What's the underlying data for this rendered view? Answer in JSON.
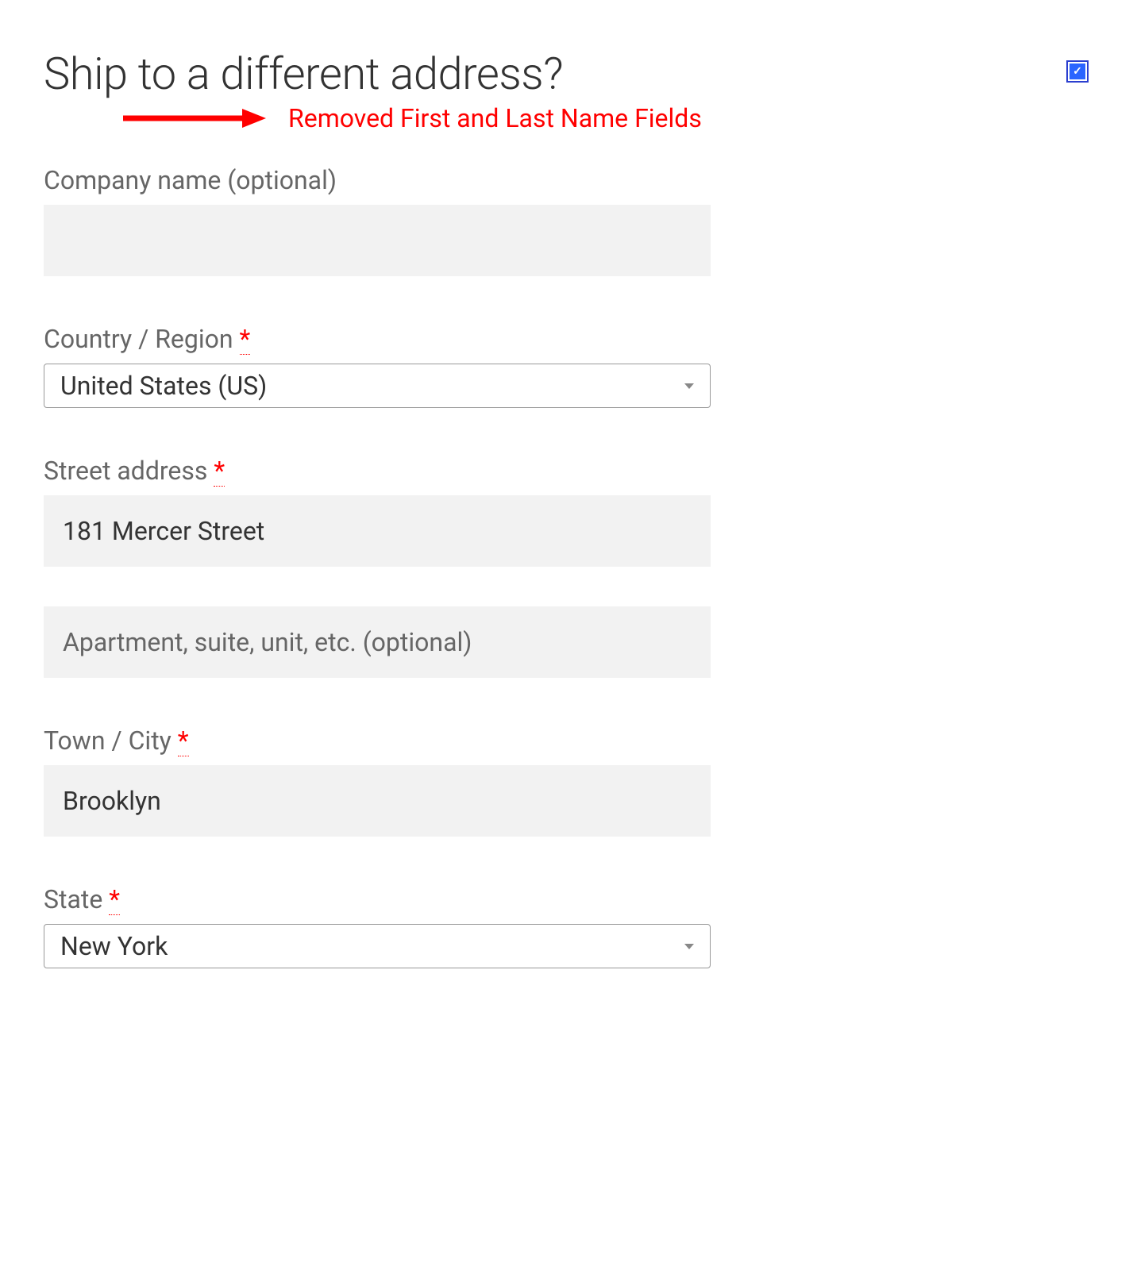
{
  "heading": "Ship to a different address?",
  "annotation": "Removed First and Last Name Fields",
  "checkbox_checked": true,
  "fields": {
    "company": {
      "label": "Company name (optional)",
      "value": ""
    },
    "country": {
      "label": "Country / Region",
      "required": "*",
      "value": "United States (US)"
    },
    "street": {
      "label": "Street address",
      "required": "*",
      "line1_value": "181 Mercer Street",
      "line2_placeholder": "Apartment, suite, unit, etc. (optional)",
      "line2_value": ""
    },
    "city": {
      "label": "Town / City",
      "required": "*",
      "value": "Brooklyn"
    },
    "state": {
      "label": "State",
      "required": "*",
      "value": "New York"
    }
  }
}
